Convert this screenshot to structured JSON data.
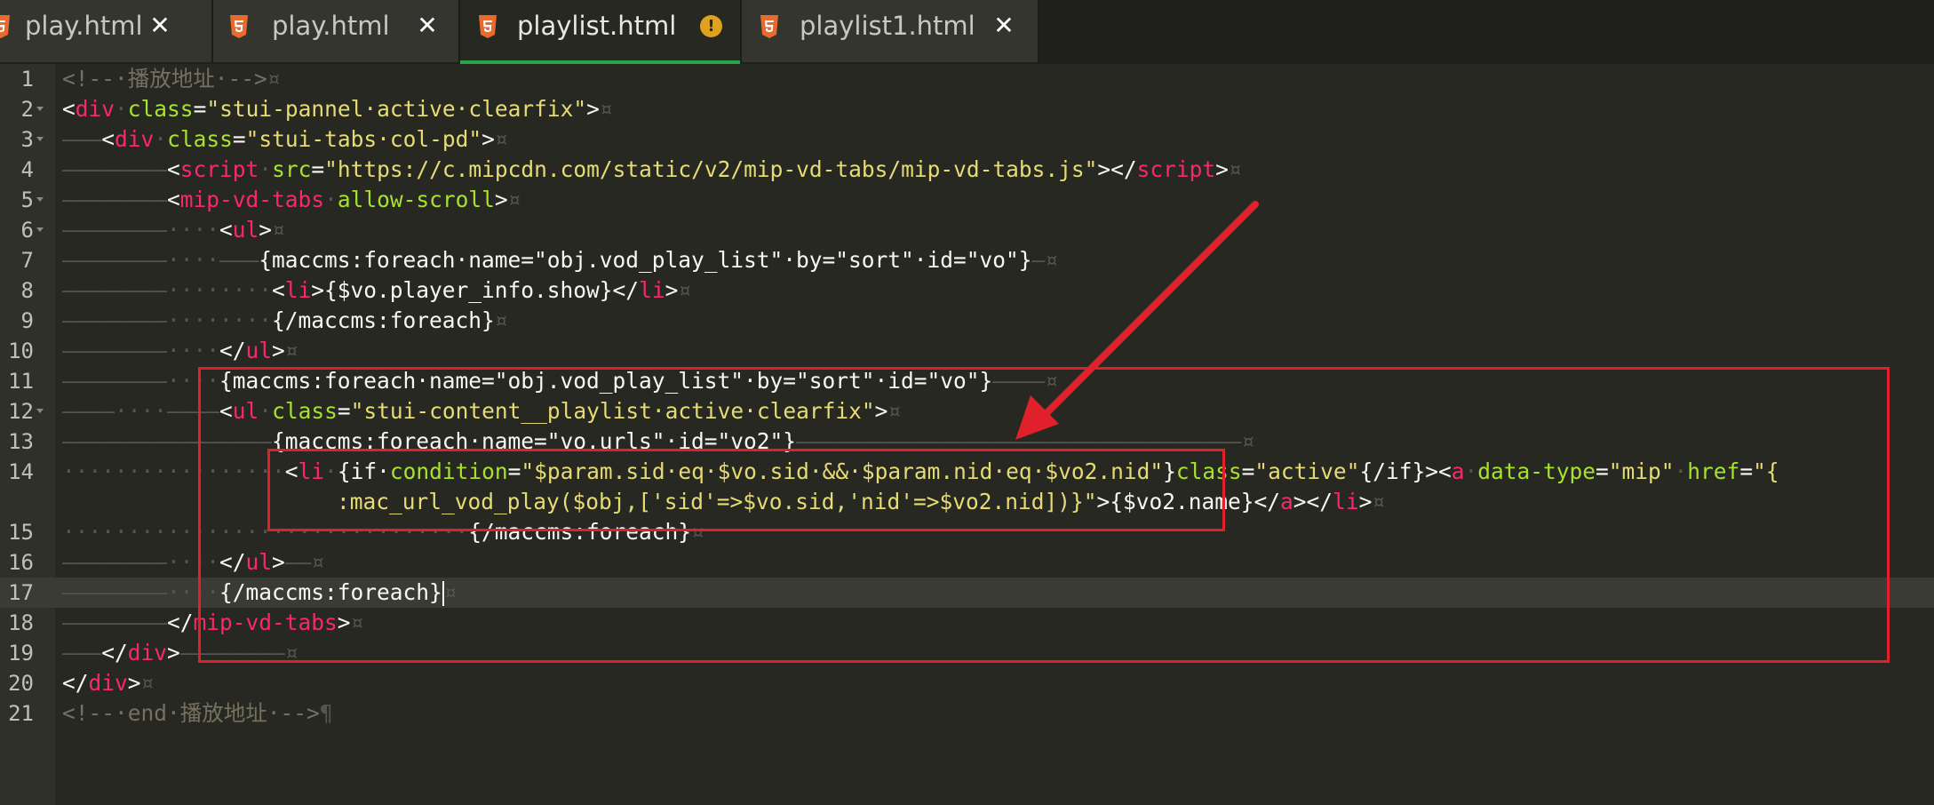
{
  "tabs": [
    {
      "label": "play.html",
      "icon": "html5-icon",
      "state": "close"
    },
    {
      "label": "play.html",
      "icon": "html5-icon",
      "state": "close"
    },
    {
      "label": "playlist.html",
      "icon": "html5-icon",
      "state": "unsaved-warning",
      "active": true
    },
    {
      "label": "playlist1.html",
      "icon": "html5-icon",
      "state": "close"
    }
  ],
  "close_glyph": "✕",
  "warn_glyph": "!",
  "line_numbers": [
    "1",
    "2",
    "3",
    "4",
    "5",
    "6",
    "7",
    "8",
    "9",
    "10",
    "11",
    "12",
    "13",
    "14",
    "",
    "15",
    "16",
    "17",
    "18",
    "19",
    "20",
    "21"
  ],
  "current_line": "17",
  "colors": {
    "tag": "#f92672",
    "attribute": "#a6e22e",
    "string": "#e6db74",
    "comment": "#75715e",
    "accent": "#2aa34a",
    "annotation": "#e0202a"
  },
  "code": {
    "l1": {
      "comment": "<!--·播放地址·-->",
      "ws": "¤"
    },
    "l2": {
      "p0": "<",
      "tag": "div",
      "sp": "·",
      "attr": "class",
      "eq": "=",
      "val": "\"stui-pannel·active·clearfix\"",
      "p1": ">",
      "ws": "¤"
    },
    "l3": {
      "indent": "———",
      "p0": "<",
      "tag": "div",
      "sp": "·",
      "attr": "class",
      "eq": "=",
      "val": "\"stui-tabs·col-pd\"",
      "p1": ">",
      "ws": "¤"
    },
    "l4": {
      "indent": "————————",
      "p0": "<",
      "tag": "script",
      "sp": "·",
      "attr": "src",
      "eq": "=",
      "val": "\"https://c.mipcdn.com/static/v2/mip-vd-tabs/mip-vd-tabs.js\"",
      "p1": "></",
      "tag2": "script",
      "p2": ">",
      "ws": "¤"
    },
    "l5": {
      "indent": "————————",
      "p0": "<",
      "tag": "mip-vd-tabs",
      "sp": "·",
      "attr": "allow-scroll",
      "p1": ">",
      "ws": "¤"
    },
    "l6": {
      "indent": "————————····",
      "p0": "<",
      "tag": "ul",
      "p1": ">",
      "ws": "¤"
    },
    "l7": {
      "indent": "————————····———",
      "text": "{maccms:foreach·name=\"obj.vod_play_list\"·by=\"sort\"·id=\"vo\"}",
      "ws": "—¤"
    },
    "l8": {
      "indent": "————————········",
      "p0": "<",
      "tag": "li",
      "p1": ">{$vo.player_info.show}</",
      "tag2": "li",
      "p2": ">",
      "ws": "¤"
    },
    "l9": {
      "indent": "————————········",
      "text": "{/maccms:foreach}",
      "ws": "¤"
    },
    "l10": {
      "indent": "————————····",
      "p0": "</",
      "tag": "ul",
      "p1": ">",
      "ws": "¤"
    },
    "l11": {
      "indent": "————————····",
      "text": "{maccms:foreach·name=\"obj.vod_play_list\"·by=\"sort\"·id=\"vo\"}",
      "ws": "————¤"
    },
    "l12": {
      "indent": "————····————",
      "p0": "<",
      "tag": "ul",
      "sp": "·",
      "attr": "class",
      "eq": "=",
      "val": "\"stui-content__playlist·active·clearfix\"",
      "p1": ">",
      "ws": "¤"
    },
    "l13": {
      "indent": "————————————————",
      "text": "{maccms:foreach·name=\"vo.urls\"·id=\"vo2\"}",
      "ws": "——————————————————————————————————¤"
    },
    "l14": {
      "indent": "·················",
      "p0": "<",
      "tag": "li",
      "sp": "·",
      "text1": "{if·",
      "attr": "condition",
      "eq": "=",
      "val": "\"$param.sid·eq·$vo.sid·&&·$param.nid·eq·$vo2.nid\"",
      "text2": "}",
      "attr2": "class",
      "eq2": "=",
      "val2": "\"active\"",
      "text3": "{/if}><",
      "tag2": "a",
      "sp2": "·",
      "attr3": "data-type",
      "eq3": "=",
      "val3": "\"mip\"",
      "sp3": "·",
      "attr4": "href",
      "eq4": "=",
      "val4": "\"{"
    },
    "l14b": {
      "val": ":mac_url_vod_play($obj,['sid'=>$vo.sid,'nid'=>$vo2.nid])}\"",
      "p1": ">{$vo2.name}</",
      "tag": "a",
      "p2": "></",
      "tag2": "li",
      "p3": ">",
      "ws": "¤"
    },
    "l15": {
      "indent": "·······························",
      "text": "{/maccms:foreach}",
      "ws": "¤"
    },
    "l16": {
      "indent": "————————····",
      "p0": "</",
      "tag": "ul",
      "p1": ">",
      "ws": "——¤"
    },
    "l17": {
      "indent": "————————····",
      "text": "{/maccms:foreach}",
      "ws": "¤"
    },
    "l18": {
      "indent": "————————",
      "p0": "</",
      "tag": "mip-vd-tabs",
      "p1": ">",
      "ws": "¤"
    },
    "l19": {
      "indent": "———",
      "p0": "</",
      "tag": "div",
      "p1": ">",
      "ws": "————————¤"
    },
    "l20": {
      "p0": "</",
      "tag": "div",
      "p1": ">",
      "ws": "¤"
    },
    "l21": {
      "comment": "<!--·end·播放地址·-->",
      "ws": "¶"
    }
  }
}
